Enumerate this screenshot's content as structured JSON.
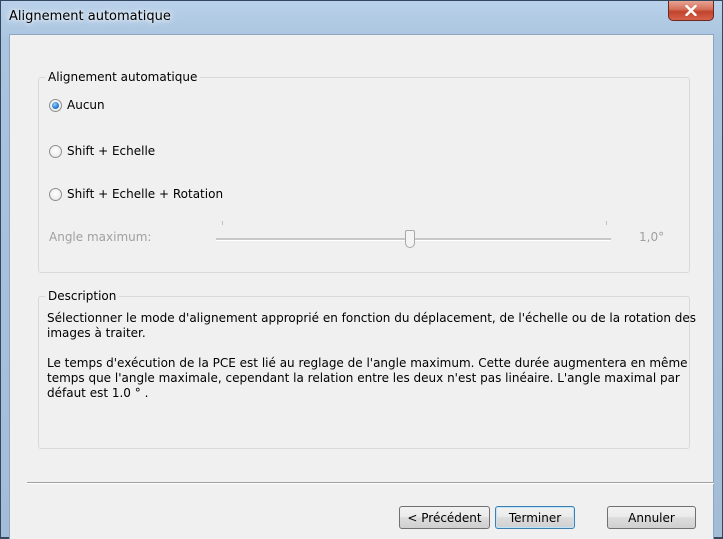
{
  "window": {
    "title": "Alignement automatique"
  },
  "alignment_group": {
    "label": "Alignement automatique",
    "options": [
      {
        "label": "Aucun",
        "checked": true
      },
      {
        "label": "Shift + Echelle",
        "checked": false
      },
      {
        "label": "Shift + Echelle + Rotation",
        "checked": false
      }
    ],
    "slider": {
      "label": "Angle maximum:",
      "value_text": "1,0°",
      "position_fraction": 0.49,
      "enabled": false
    }
  },
  "description_group": {
    "label": "Description",
    "paragraph1": "Sélectionner le mode d'alignement approprié en fonction du déplacement, de l'échelle ou de la rotation des images à traiter.",
    "paragraph2": "Le temps d'exécution de la PCE est lié au reglage de l'angle maximum. Cette durée augmentera en même temps que l'angle maximale, cependant la relation entre les deux n'est pas linéaire. L'angle maximal par défaut est 1.0 ° ."
  },
  "buttons": {
    "previous": "< Précédent",
    "finish": "Terminer",
    "cancel": "Annuler"
  },
  "colors": {
    "title_bar": "#b9d1ea",
    "close_button": "#c2432c",
    "default_button_border": "#3c7fb1"
  }
}
